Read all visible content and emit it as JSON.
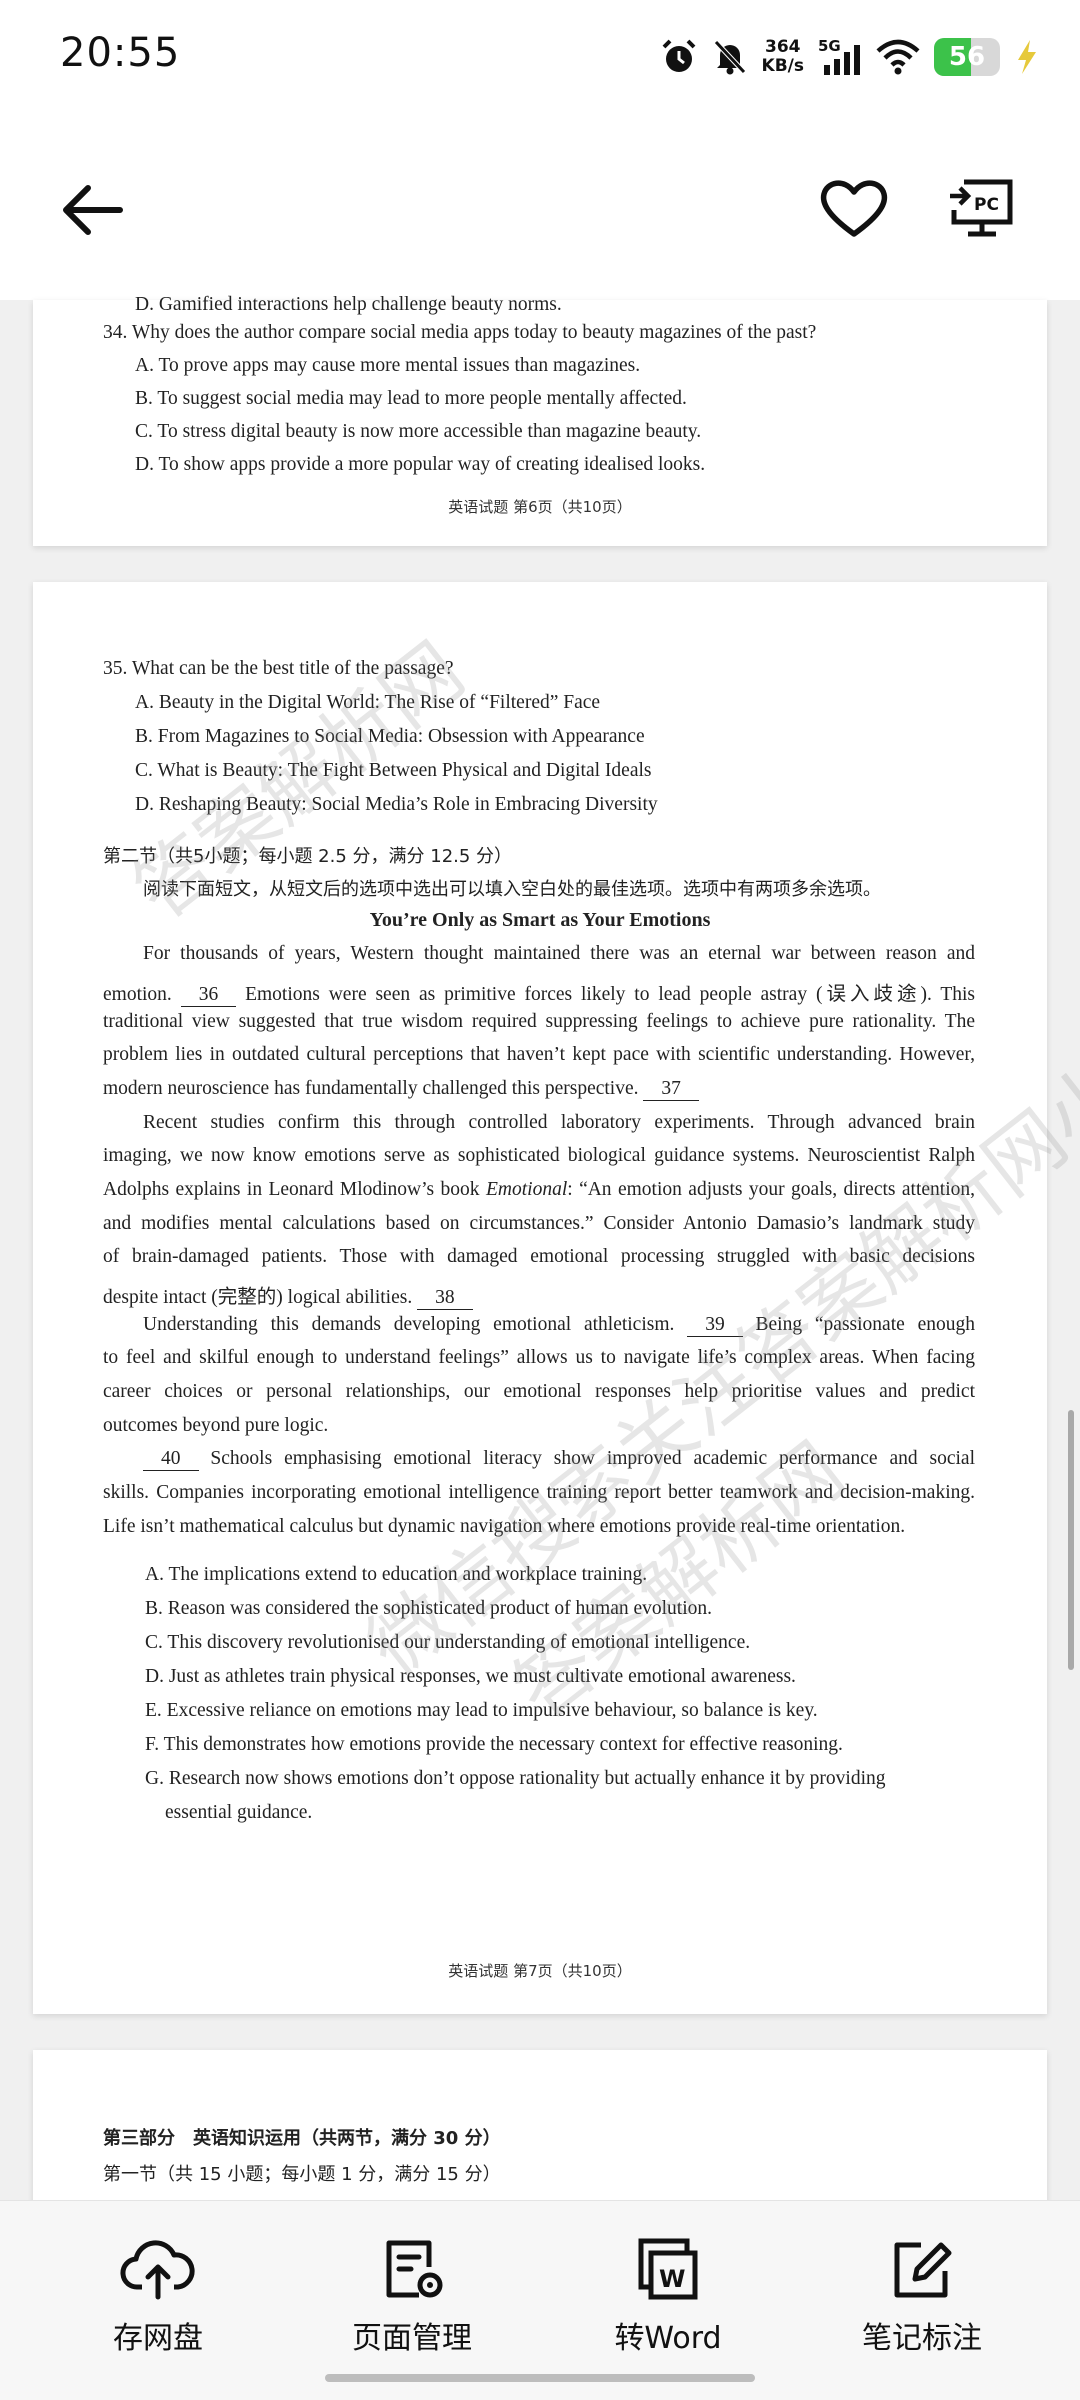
{
  "status_bar": {
    "time": "20:55",
    "net_speed_value": "364",
    "net_speed_unit": "KB/s",
    "network": "5G",
    "battery": "56",
    "battery_level_pct": 56
  },
  "top_bar": {
    "back_icon": "arrow-left-icon",
    "favorite_icon": "heart-icon",
    "pc_icon": "send-to-pc-icon",
    "pc_label": "PC"
  },
  "page6": {
    "partial_line": "D. Gamified interactions help challenge beauty norms.",
    "q34": "34. Why does the author compare social media apps today to beauty magazines of the past?",
    "q34_options": [
      "A. To prove apps may cause more mental issues than magazines.",
      "B. To suggest social media may lead to more people mentally affected.",
      "C. To stress digital beauty is now more accessible than magazine beauty.",
      "D. To show apps provide a more popular way of creating idealised looks."
    ],
    "footer": "英语试题 第6页（共10页）"
  },
  "page7": {
    "q35": "35. What can be the best title of the passage?",
    "q35_options": [
      "A. Beauty in the Digital World: The Rise of “Filtered” Face",
      "B. From Magazines to Social Media: Obsession with Appearance",
      "C. What is Beauty: The Fight Between Physical and Digital Ideals",
      "D. Reshaping Beauty: Social Media’s Role in Embracing Diversity"
    ],
    "section_heading": "第二节（共5小题；每小题 2.5 分，满分 12.5 分）",
    "instructions": "阅读下面短文，从短文后的选项中选出可以填入空白处的最佳选项。选项中有两项多余选项。",
    "title": "You’re Only as Smart as Your Emotions",
    "blanks": [
      "36",
      "37",
      "38",
      "39",
      "40"
    ],
    "p1": {
      "l1": "For thousands of years, Western thought maintained there was an eternal war between reason and",
      "l2a": "emotion.",
      "l2b": "Emotions were seen as primitive forces likely to lead people astray (误入歧途). This",
      "l3": "traditional view suggested that true wisdom required suppressing feelings to achieve pure rationality. The",
      "l4": "problem lies in outdated cultural perceptions that haven’t kept pace with scientific understanding. However,",
      "l5": "modern neuroscience has fundamentally challenged this perspective."
    },
    "p2": {
      "l1": "Recent studies confirm this through controlled laboratory experiments. Through advanced brain",
      "l2": "imaging, we now know emotions serve as sophisticated biological guidance systems. Neuroscientist Ralph",
      "l3a": "Adolphs explains in Leonard Mlodinow’s book",
      "l3_book": "Emotional",
      "l3b": ": “An emotion adjusts your goals, directs attention,",
      "l4": "and modifies mental calculations based on circumstances.” Consider Antonio Damasio’s landmark study",
      "l5": "of brain-damaged patients. Those with damaged emotional processing struggled with basic decisions",
      "l6": "despite intact (完整的) logical abilities."
    },
    "p3": {
      "l1a": "Understanding this demands developing emotional athleticism.",
      "l1b": "Being “passionate enough",
      "l2": "to feel and skilful enough to understand feelings” allows us to navigate life’s complex areas. When facing",
      "l3": "career choices or personal relationships, our emotional responses help prioritise values and predict",
      "l4": "outcomes beyond pure logic."
    },
    "p4": {
      "l1b": "Schools emphasising emotional literacy show improved academic performance and social",
      "l2": "skills. Companies incorporating emotional intelligence training report better teamwork and decision-making.",
      "l3": "Life isn’t mathematical calculus but dynamic navigation where emotions provide real-time orientation."
    },
    "options": [
      "A. The implications extend to education and workplace training.",
      "B. Reason was considered the sophisticated product of human evolution.",
      "C. This discovery revolutionised our understanding of emotional intelligence.",
      "D. Just as athletes train physical responses, we must cultivate emotional awareness.",
      "E. Excessive reliance on emotions may lead to impulsive behaviour, so balance is key.",
      "F. This demonstrates how emotions provide the necessary context for effective reasoning.",
      "G. Research now shows emotions don’t oppose rationality but actually enhance it by providing"
    ],
    "option_g_cont": "essential guidance.",
    "footer": "英语试题 第7页（共10页）"
  },
  "page8": {
    "part_heading": "第三部分　英语知识运用（共两节，满分 30 分）",
    "section_heading": "第一节（共 15 小题；每小题 1 分，满分 15 分）"
  },
  "watermark": {
    "text1": "答案解析网",
    "text2": "微信搜索关注答案解析网小程序",
    "text3": "答案解析网"
  },
  "bottom_bar": {
    "items": [
      {
        "label": "存网盘",
        "icon": "cloud-upload-icon"
      },
      {
        "label": "页面管理",
        "icon": "page-settings-icon"
      },
      {
        "label": "转Word",
        "icon": "word-convert-icon"
      },
      {
        "label": "笔记标注",
        "icon": "edit-note-icon"
      }
    ]
  }
}
